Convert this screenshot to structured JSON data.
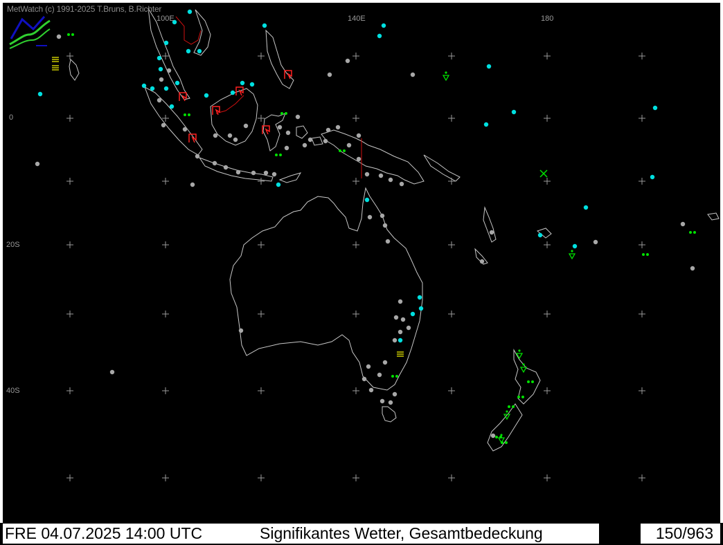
{
  "header": {
    "credit": "MetWatch  (c) 1991-2025 T.Bruns, B.Richter"
  },
  "map": {
    "longitude_labels": [
      "100E",
      "140E",
      "180"
    ],
    "latitude_labels": [
      "0",
      "20S",
      "40S"
    ],
    "colors": {
      "background": "#000000",
      "coastline": "#c8c8c8",
      "border": "#d01010",
      "gray_station": "#a8a8a8",
      "cyan_station": "#00e0e0",
      "green_weather": "#00e000",
      "yellow_weather": "#ffff00",
      "red_weather": "#ff2020"
    },
    "icons": {
      "logo": "metwatch-logo-icon",
      "thunderstorm": "thunderstorm-icon",
      "fog": "fog-icon",
      "shower": "shower-icon",
      "drizzle": "drizzle-icon",
      "grid_cross": "grid-cross-icon"
    }
  },
  "status_bar": {
    "datetime": "FRE 04.07.2025 14:00 UTC",
    "title": "Signifikantes Wetter, Gesamtbedeckung",
    "page": "150/963"
  }
}
